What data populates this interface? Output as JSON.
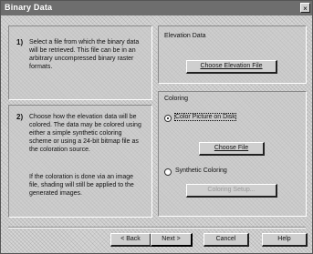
{
  "window": {
    "title": "Binary Data",
    "close_glyph": "×"
  },
  "steps": {
    "step1": {
      "number": "1)",
      "text": "Select a file from which the binary data will be retrieved. This file can be in an arbitrary uncompressed binary raster formats."
    },
    "step2": {
      "number": "2)",
      "text": "Choose how the elevation data will be colored. The data may be colored using either a simple synthetic coloring scheme or using a 24-bit bitmap file as the coloration source.",
      "note": "If the coloration is done via an image file, shading will still be applied to the generated images."
    }
  },
  "elevation": {
    "heading": "Elevation Data",
    "choose_button": "Choose Elevation File"
  },
  "coloring": {
    "heading": "Coloring",
    "options": [
      {
        "label": "Color Picture on Disk",
        "checked": true
      },
      {
        "label": "Synthetic Coloring",
        "checked": false
      }
    ],
    "choose_file_button": "Choose File",
    "coloring_button": "Coloring Setup..."
  },
  "footer": {
    "back": "< Back",
    "next": "Next >",
    "cancel": "Cancel",
    "help": "Help"
  }
}
